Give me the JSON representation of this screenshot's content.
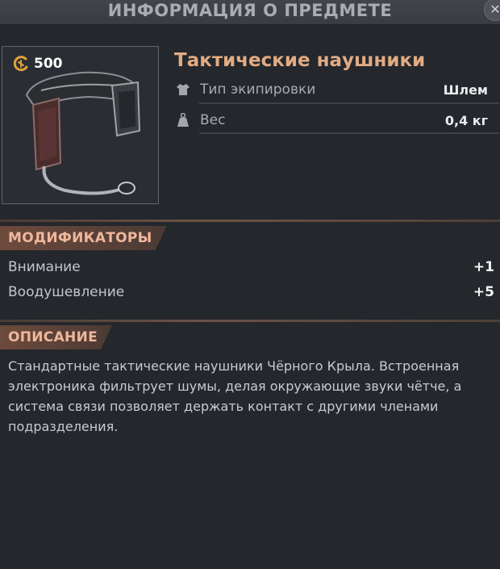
{
  "header": {
    "title": "ИНФОРМАЦИЯ О ПРЕДМЕТЕ",
    "close_icon": "close-icon"
  },
  "item": {
    "name": "Тактические наушники",
    "cost": "500",
    "cost_icon": "coin-icon",
    "image_icon": "headset-icon",
    "stats": [
      {
        "icon": "shirt-icon",
        "label": "Тип экипировки",
        "value": "Шлем"
      },
      {
        "icon": "weight-icon",
        "label": "Вес",
        "value": "0,4 кг"
      }
    ]
  },
  "modifiers": {
    "title": "МОДИФИКАТОРЫ",
    "rows": [
      {
        "label": "Внимание",
        "value": "+1"
      },
      {
        "label": "Воодушевление",
        "value": "+5"
      }
    ]
  },
  "description": {
    "title": "ОПИСАНИЕ",
    "text": "Стандартные тактические наушники Чёрного Крыла. Встроенная электроника фильтрует шумы, делая окружающие звуки чётче, а система связи позволяет держать контакт с другими членами подразделения."
  },
  "colors": {
    "background": "#24272c",
    "accent": "#e1ab84",
    "section_tab": "#6d4a3c"
  }
}
